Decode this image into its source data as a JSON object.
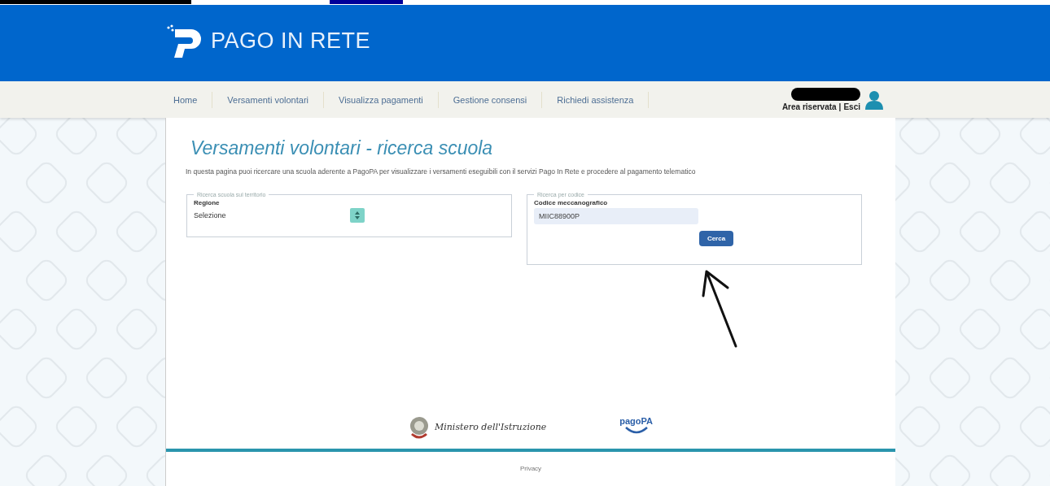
{
  "header": {
    "logo_text": "PAGO IN RETE"
  },
  "nav": {
    "items": [
      {
        "label": "Home"
      },
      {
        "label": "Versamenti volontari"
      },
      {
        "label": "Visualizza pagamenti"
      },
      {
        "label": "Gestione consensi"
      },
      {
        "label": "Richiedi assistenza"
      }
    ],
    "user_links": [
      {
        "label": "Area riservata"
      },
      {
        "label": "Esci"
      }
    ],
    "user_separator": "|"
  },
  "page": {
    "title": "Versamenti volontari - ricerca scuola",
    "description": "In questa pagina puoi ricercare una scuola aderente a PagoPA per visualizzare i versamenti eseguibili con il servizi Pago In Rete e procedere al pagamento telematico"
  },
  "territory_search": {
    "legend": "Ricerca scuola sul territorio",
    "label": "Regione",
    "value": "Selezione"
  },
  "code_search": {
    "legend": "Ricerca per codice",
    "label": "Codice meccanografico",
    "value": "MIIC88900P",
    "button": "Cerca"
  },
  "footer": {
    "ministry": "Ministero dell'Istruzione",
    "pagopa": "pagoPA",
    "link": "Privacy"
  }
}
